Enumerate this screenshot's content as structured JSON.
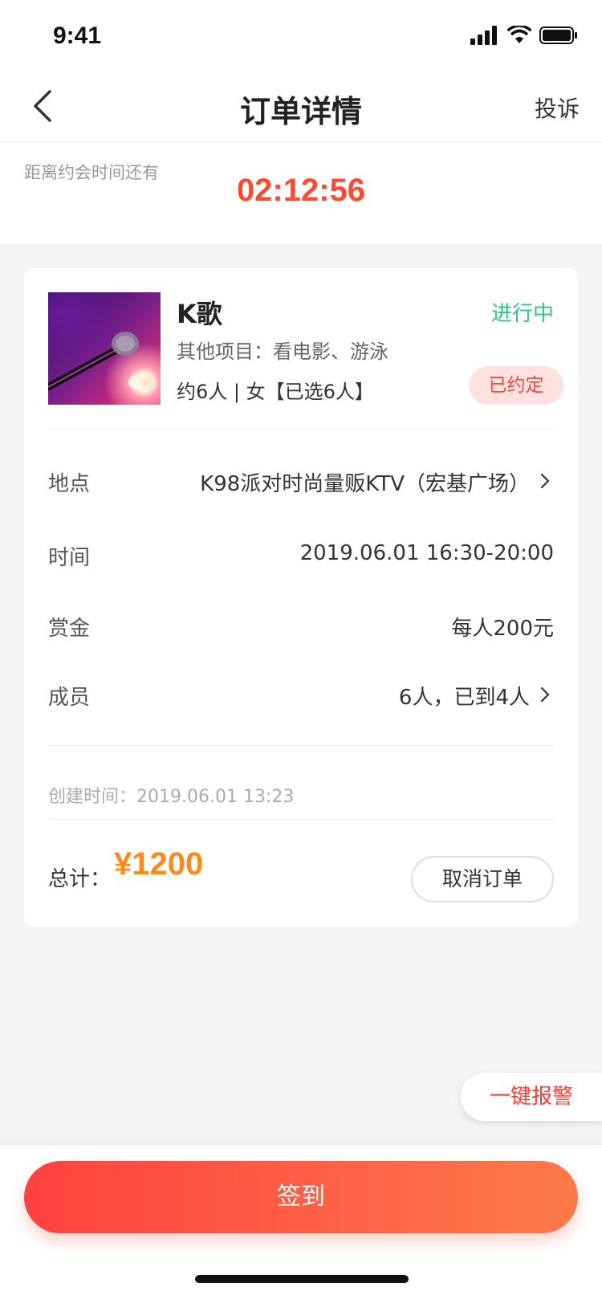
{
  "status_bar": {
    "time": "9:41"
  },
  "nav": {
    "title": "订单详情",
    "complain_label": "投诉"
  },
  "countdown": {
    "label": "距离约会时间还有",
    "time": "02:12:56"
  },
  "order": {
    "title": "K歌",
    "other_items": "其他项目：看电影、游泳",
    "people": "约6人 | 女【已选6人】",
    "status_text": "进行中",
    "status_badge": "已约定",
    "rows": [
      {
        "label": "地点",
        "value": "K98派对时尚量贩KTV（宏基广场）"
      },
      {
        "label": "时间",
        "value": "2019.06.01 16:30-20:00"
      },
      {
        "label": "赏金",
        "value": "每人200元"
      },
      {
        "label": "成员",
        "value": "6人，已到4人"
      }
    ],
    "created_time": "创建时间：2019.06.01 13:23",
    "total_label": "总计：",
    "total_amount": "¥1200",
    "cancel_label": "取消订单"
  },
  "alarm_label": "一键报警",
  "checkin_label": "签到",
  "colors": {
    "accent": "#ff4a32",
    "status_green": "#2bc48a",
    "price_orange": "#ff8a1c"
  }
}
